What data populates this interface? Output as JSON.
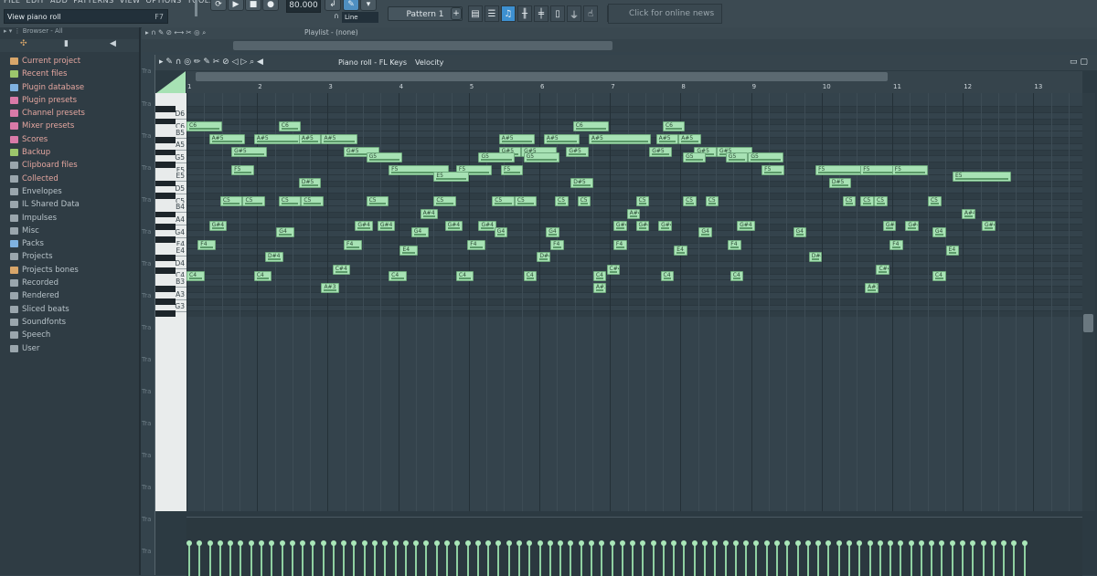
{
  "menu": [
    "FILE",
    "EDIT",
    "ADD",
    "PATTERNS",
    "VIEW",
    "OPTIONS",
    "TOOLS",
    "?"
  ],
  "hint": {
    "text": "View piano roll",
    "key": "F7"
  },
  "transport": {
    "tempo": "80.000",
    "snap_label": "Line"
  },
  "pattern": {
    "name": "Pattern 1",
    "add": "+"
  },
  "news": {
    "text": "Click for online news"
  },
  "browser": {
    "header": "Browser - All",
    "items": [
      {
        "label": "Current project",
        "icon": "folder-icon",
        "color": "#d8a66a"
      },
      {
        "label": "Recent files",
        "icon": "folder-icon",
        "color": "#9cc66c"
      },
      {
        "label": "Plugin database",
        "icon": "plugin-icon",
        "color": "#7fb2e0"
      },
      {
        "label": "Plugin presets",
        "icon": "plugin-icon",
        "color": "#d97aa8"
      },
      {
        "label": "Channel presets",
        "icon": "plugin-icon",
        "color": "#d97aa8"
      },
      {
        "label": "Mixer presets",
        "icon": "plugin-icon",
        "color": "#d97aa8"
      },
      {
        "label": "Scores",
        "icon": "note-icon",
        "color": "#d97aa8"
      },
      {
        "label": "Backup",
        "icon": "folder-icon",
        "color": "#9cc66c"
      },
      {
        "label": "Clipboard files",
        "icon": "folder-icon",
        "color": "#9aa6ad"
      },
      {
        "label": "Collected",
        "icon": "folder-icon",
        "color": "#9aa6ad"
      },
      {
        "label": "Envelopes",
        "icon": "folder-icon",
        "color": "#9aa6ad"
      },
      {
        "label": "IL Shared Data",
        "icon": "folder-icon",
        "color": "#9aa6ad"
      },
      {
        "label": "Impulses",
        "icon": "folder-icon",
        "color": "#9aa6ad"
      },
      {
        "label": "Misc",
        "icon": "folder-icon",
        "color": "#9aa6ad"
      },
      {
        "label": "Packs",
        "icon": "folder-icon",
        "color": "#7fb2e0"
      },
      {
        "label": "Projects",
        "icon": "folder-icon",
        "color": "#9aa6ad"
      },
      {
        "label": "Projects bones",
        "icon": "folder-icon",
        "color": "#d8a66a"
      },
      {
        "label": "Recorded",
        "icon": "plus-icon",
        "color": "#9aa6ad"
      },
      {
        "label": "Rendered",
        "icon": "plus-icon",
        "color": "#9aa6ad"
      },
      {
        "label": "Sliced beats",
        "icon": "plus-icon",
        "color": "#9aa6ad"
      },
      {
        "label": "Soundfonts",
        "icon": "folder-icon",
        "color": "#9aa6ad"
      },
      {
        "label": "Speech",
        "icon": "speech-icon",
        "color": "#9aa6ad"
      },
      {
        "label": "User",
        "icon": "user-icon",
        "color": "#9aa6ad"
      }
    ]
  },
  "playlist": {
    "title": "Playlist - (none)",
    "track_label": "Tra"
  },
  "piano_roll": {
    "title": "Piano roll - FL Keys",
    "target": "Velocity",
    "bars": [
      "1",
      "2",
      "3",
      "4",
      "5",
      "6",
      "7",
      "8",
      "9",
      "10",
      "11",
      "12",
      "13"
    ],
    "keys": [
      "D6",
      "C6",
      "B5",
      "A5",
      "G5",
      "F5",
      "E5",
      "D5",
      "C5",
      "B4",
      "A4",
      "G4",
      "F4",
      "E4",
      "D4",
      "C4",
      "B3",
      "A3",
      "G3"
    ],
    "notes": [
      {
        "p": "C6",
        "s": 0,
        "l": 1.6
      },
      {
        "p": "C6",
        "s": 4.1,
        "l": 1
      },
      {
        "p": "C6",
        "s": 17.2,
        "l": 1.6
      },
      {
        "p": "C6",
        "s": 21.2,
        "l": 1
      },
      {
        "p": "A#5",
        "s": 1,
        "l": 1.6
      },
      {
        "p": "A#5",
        "s": 3,
        "l": 2.1
      },
      {
        "p": "A#5",
        "s": 5,
        "l": 1
      },
      {
        "p": "A#5",
        "s": 6,
        "l": 1.6
      },
      {
        "p": "A#5",
        "s": 13.9,
        "l": 1.6
      },
      {
        "p": "A#5",
        "s": 15.9,
        "l": 1.6
      },
      {
        "p": "A#5",
        "s": 17.9,
        "l": 2.8
      },
      {
        "p": "A#5",
        "s": 20.9,
        "l": 1
      },
      {
        "p": "A#5",
        "s": 21.9,
        "l": 1
      },
      {
        "p": "G#5",
        "s": 2,
        "l": 1.6
      },
      {
        "p": "G#5",
        "s": 7,
        "l": 1.6
      },
      {
        "p": "G#5",
        "s": 13.9,
        "l": 1
      },
      {
        "p": "G#5",
        "s": 14.9,
        "l": 1.6
      },
      {
        "p": "G#5",
        "s": 16.9,
        "l": 1
      },
      {
        "p": "G#5",
        "s": 20.6,
        "l": 1
      },
      {
        "p": "G#5",
        "s": 22.6,
        "l": 1
      },
      {
        "p": "G#5",
        "s": 23.6,
        "l": 1.6
      },
      {
        "p": "G5",
        "s": 8,
        "l": 1.6
      },
      {
        "p": "G5",
        "s": 13,
        "l": 1.6
      },
      {
        "p": "G5",
        "s": 15,
        "l": 1.6
      },
      {
        "p": "G5",
        "s": 22.1,
        "l": 1
      },
      {
        "p": "G5",
        "s": 24,
        "l": 1
      },
      {
        "p": "G5",
        "s": 25,
        "l": 1.6
      },
      {
        "p": "F5",
        "s": 2,
        "l": 1
      },
      {
        "p": "F5",
        "s": 9,
        "l": 2.7
      },
      {
        "p": "F5",
        "s": 12,
        "l": 1.6
      },
      {
        "p": "F5",
        "s": 14,
        "l": 1
      },
      {
        "p": "F5",
        "s": 25.6,
        "l": 1
      },
      {
        "p": "F5",
        "s": 28,
        "l": 2.6
      },
      {
        "p": "F5",
        "s": 30,
        "l": 1.6
      },
      {
        "p": "F5",
        "s": 31.4,
        "l": 1.6
      },
      {
        "p": "E5",
        "s": 11,
        "l": 1.6
      },
      {
        "p": "E5",
        "s": 34.1,
        "l": 2.6
      },
      {
        "p": "D#5",
        "s": 5,
        "l": 1
      },
      {
        "p": "D#5",
        "s": 17.1,
        "l": 1
      },
      {
        "p": "D#5",
        "s": 28.6,
        "l": 1
      },
      {
        "p": "C5",
        "s": 1.5,
        "l": 1
      },
      {
        "p": "C5",
        "s": 2.5,
        "l": 1
      },
      {
        "p": "C5",
        "s": 4.1,
        "l": 1
      },
      {
        "p": "C5",
        "s": 5.1,
        "l": 1
      },
      {
        "p": "C5",
        "s": 8,
        "l": 1
      },
      {
        "p": "C5",
        "s": 11,
        "l": 1
      },
      {
        "p": "C5",
        "s": 13.6,
        "l": 1
      },
      {
        "p": "C5",
        "s": 14.6,
        "l": 1
      },
      {
        "p": "C5",
        "s": 16.4,
        "l": 0.6
      },
      {
        "p": "C5",
        "s": 17.4,
        "l": 0.6
      },
      {
        "p": "C5",
        "s": 20,
        "l": 0.6
      },
      {
        "p": "C5",
        "s": 22.1,
        "l": 0.6
      },
      {
        "p": "C5",
        "s": 23.1,
        "l": 0.6
      },
      {
        "p": "C5",
        "s": 30,
        "l": 0.6
      },
      {
        "p": "C5",
        "s": 29.2,
        "l": 0.6
      },
      {
        "p": "C5",
        "s": 33,
        "l": 0.6
      },
      {
        "p": "C5",
        "s": 30.6,
        "l": 0.6
      },
      {
        "p": "A#4",
        "s": 10.4,
        "l": 0.8
      },
      {
        "p": "A#4",
        "s": 19.6,
        "l": 0.6
      },
      {
        "p": "A#4",
        "s": 34.5,
        "l": 0.6
      },
      {
        "p": "G#4",
        "s": 1,
        "l": 0.8
      },
      {
        "p": "G#4",
        "s": 7.5,
        "l": 0.8
      },
      {
        "p": "G#4",
        "s": 8.5,
        "l": 0.8
      },
      {
        "p": "G#4",
        "s": 11.5,
        "l": 0.8
      },
      {
        "p": "G#4",
        "s": 13,
        "l": 0.8
      },
      {
        "p": "G#4",
        "s": 19,
        "l": 0.6
      },
      {
        "p": "G#4",
        "s": 20,
        "l": 0.6
      },
      {
        "p": "G#4",
        "s": 21,
        "l": 0.6
      },
      {
        "p": "G#4",
        "s": 24.5,
        "l": 0.8
      },
      {
        "p": "G#4",
        "s": 31,
        "l": 0.6
      },
      {
        "p": "G#4",
        "s": 32,
        "l": 0.6
      },
      {
        "p": "G#4",
        "s": 35.4,
        "l": 0.6
      },
      {
        "p": "G4",
        "s": 4,
        "l": 0.8
      },
      {
        "p": "G4",
        "s": 10,
        "l": 0.8
      },
      {
        "p": "G4",
        "s": 16,
        "l": 0.6
      },
      {
        "p": "G4",
        "s": 22.8,
        "l": 0.6
      },
      {
        "p": "G4",
        "s": 27,
        "l": 0.6
      },
      {
        "p": "G4",
        "s": 33.2,
        "l": 0.6
      },
      {
        "p": "G4",
        "s": 13.7,
        "l": 0.6
      },
      {
        "p": "F4",
        "s": 0.5,
        "l": 0.8
      },
      {
        "p": "F4",
        "s": 7,
        "l": 0.8
      },
      {
        "p": "F4",
        "s": 12.5,
        "l": 0.8
      },
      {
        "p": "F4",
        "s": 19,
        "l": 0.6
      },
      {
        "p": "F4",
        "s": 24.1,
        "l": 0.6
      },
      {
        "p": "F4",
        "s": 31.3,
        "l": 0.6
      },
      {
        "p": "F4",
        "s": 16.2,
        "l": 0.6
      },
      {
        "p": "E4",
        "s": 9.5,
        "l": 0.8
      },
      {
        "p": "E4",
        "s": 21.7,
        "l": 0.6
      },
      {
        "p": "E4",
        "s": 33.8,
        "l": 0.6
      },
      {
        "p": "D#4",
        "s": 3.5,
        "l": 0.8
      },
      {
        "p": "D#4",
        "s": 15.6,
        "l": 0.6
      },
      {
        "p": "D#4",
        "s": 27.7,
        "l": 0.6
      },
      {
        "p": "C#4",
        "s": 6.5,
        "l": 0.8
      },
      {
        "p": "C#4",
        "s": 18.7,
        "l": 0.6
      },
      {
        "p": "C#4",
        "s": 30.7,
        "l": 0.6
      },
      {
        "p": "C4",
        "s": 0,
        "l": 0.8
      },
      {
        "p": "C4",
        "s": 3,
        "l": 0.8
      },
      {
        "p": "C4",
        "s": 9,
        "l": 0.8
      },
      {
        "p": "C4",
        "s": 12,
        "l": 0.8
      },
      {
        "p": "C4",
        "s": 15,
        "l": 0.6
      },
      {
        "p": "C4",
        "s": 21.1,
        "l": 0.6
      },
      {
        "p": "C4",
        "s": 18.1,
        "l": 0.6
      },
      {
        "p": "C4",
        "s": 24.2,
        "l": 0.6
      },
      {
        "p": "C4",
        "s": 33.2,
        "l": 0.6
      },
      {
        "p": "A#3",
        "s": 6,
        "l": 0.8
      },
      {
        "p": "A#3",
        "s": 18.1,
        "l": 0.6
      },
      {
        "p": "A#3",
        "s": 30.2,
        "l": 0.6
      }
    ]
  }
}
